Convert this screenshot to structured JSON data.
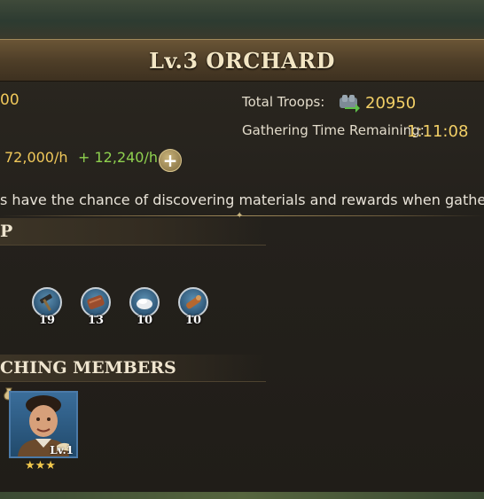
{
  "title": "Lv.3 ORCHARD",
  "info": {
    "left_value": "00",
    "total_troops_label": "Total Troops:",
    "total_troops_value": "20950",
    "gathering_time_label": "Gathering Time Remaining:",
    "gathering_time_value": "1:11:08",
    "rate": "72,000/h",
    "bonus": "+ 12,240/h",
    "plus_label": "+"
  },
  "description": "s have the chance of discovering materials and rewards when gatherin",
  "section_rewards": {
    "title": "P"
  },
  "rewards": [
    {
      "icon": "hammer-icon",
      "count": "19"
    },
    {
      "icon": "leather-icon",
      "count": "13"
    },
    {
      "icon": "stone-icon",
      "count": "10"
    },
    {
      "icon": "wood-log-icon",
      "count": "10"
    }
  ],
  "section_members": {
    "title": "CHING MEMBERS"
  },
  "member": {
    "level": "Lv.1",
    "stars": "★★★"
  },
  "colors": {
    "gold": "#f2cf66",
    "green": "#8fd14f",
    "title": "#f3e6c4"
  }
}
